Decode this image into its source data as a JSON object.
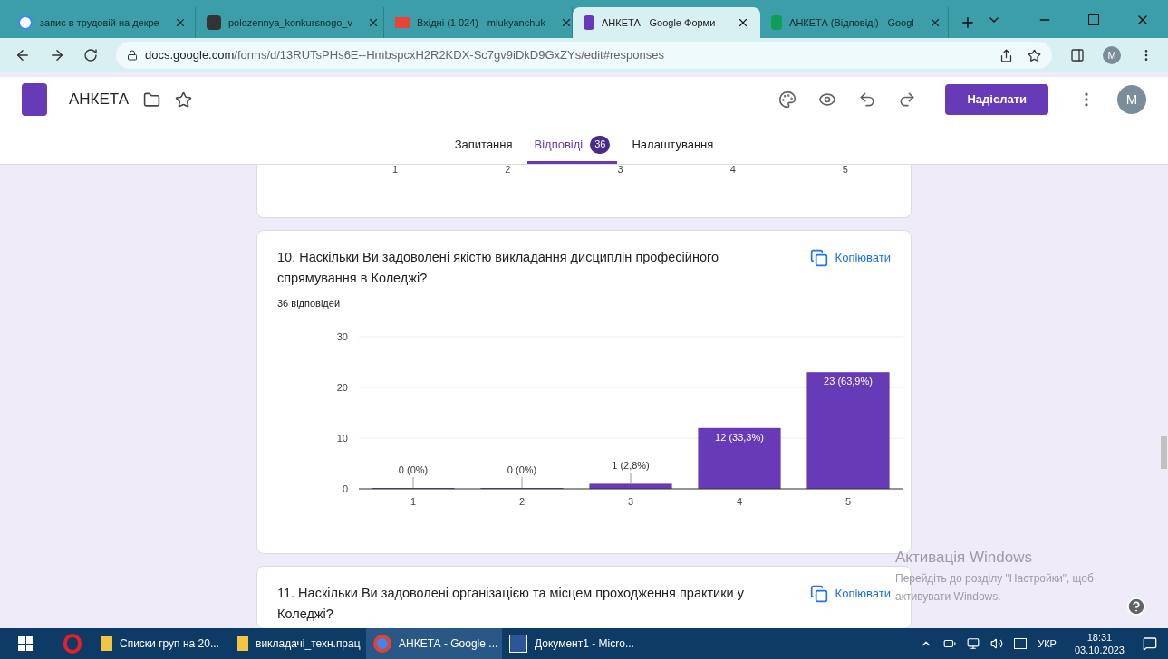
{
  "browser": {
    "tabs": [
      {
        "title": "запис в трудовій на декре",
        "kind": "google",
        "selected": false
      },
      {
        "title": "polozennya_konkursnogo_v",
        "kind": "doc",
        "selected": false
      },
      {
        "title": "Вхідні (1 024) - mlukyanchuk",
        "kind": "mail",
        "selected": false
      },
      {
        "title": "АНКЕТА - Google Форми",
        "kind": "forms",
        "selected": true
      },
      {
        "title": "АНКЕТА (Відповіді) - Googl",
        "kind": "sheets",
        "selected": false
      }
    ],
    "url_host": "docs.google.com",
    "url_path": "/forms/d/13RUTsPHs6E--HmbspcxH2R2KDX-Sc7gv9iDkD9GxZYs/edit#responses",
    "profile": "M"
  },
  "form": {
    "title": "АНКЕТА",
    "send_button": "Надіслати",
    "avatar": "M",
    "tabs": [
      {
        "label": "Запитання",
        "selected": false
      },
      {
        "label": "Відповіді",
        "badge": "36",
        "selected": true
      },
      {
        "label": "Налаштування",
        "selected": false
      }
    ]
  },
  "previous_card": {
    "axis_labels": [
      "1",
      "2",
      "3",
      "4",
      "5"
    ]
  },
  "questions": [
    {
      "title": "10. Наскільки Ви задоволені якістю викладання дисциплін  професійного спрямування в Коледжі?",
      "copy_label": "Копіювати",
      "responses": "36 відповідей",
      "chart_data": {
        "type": "bar",
        "categories": [
          "1",
          "2",
          "3",
          "4",
          "5"
        ],
        "series": [
          {
            "color": "#673ab7",
            "values": [
              0,
              0,
              1,
              12,
              23
            ]
          }
        ],
        "ylim": [
          0,
          30
        ],
        "yticks": [
          0,
          10,
          20,
          30
        ],
        "value_labels": [
          "0 (0%)",
          "0 (0%)",
          "1 (2,8%)",
          "12 (33,3%)",
          "23 (63,9%)"
        ]
      }
    },
    {
      "title": "11. Наскільки Ви задоволені організацією та місцем проходження практики у Коледжі?",
      "copy_label": "Копіювати"
    }
  ],
  "windows_notice": {
    "title": "Активація Windows",
    "text": "Перейдіть до розділу \"Настройки\", щоб активувати Windows."
  },
  "taskbar": {
    "items": [
      {
        "label": "Списки груп на 20...",
        "kind": "folder",
        "selected": false
      },
      {
        "label": "викладачі_техн.прац",
        "kind": "folder",
        "selected": false
      },
      {
        "label": "АНКЕТА - Google ...",
        "kind": "chrome",
        "selected": true
      },
      {
        "label": "Документ1 - Micro...",
        "kind": "word",
        "selected": false
      }
    ],
    "language": "УКР",
    "time": "18:31",
    "date": "03.10.2023"
  }
}
